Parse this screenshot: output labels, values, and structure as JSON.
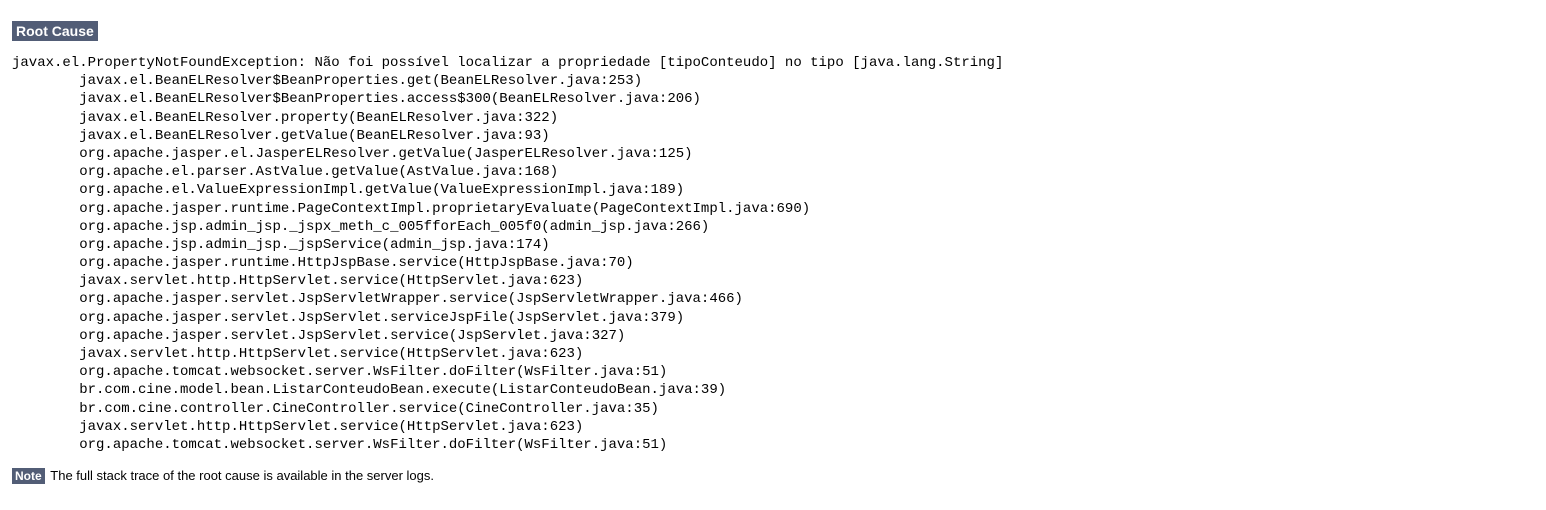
{
  "header": {
    "label": "Root Cause"
  },
  "stack": {
    "text": "javax.el.PropertyNotFoundException: Não foi possível localizar a propriedade [tipoConteudo] no tipo [java.lang.String]\n\tjavax.el.BeanELResolver$BeanProperties.get(BeanELResolver.java:253)\n\tjavax.el.BeanELResolver$BeanProperties.access$300(BeanELResolver.java:206)\n\tjavax.el.BeanELResolver.property(BeanELResolver.java:322)\n\tjavax.el.BeanELResolver.getValue(BeanELResolver.java:93)\n\torg.apache.jasper.el.JasperELResolver.getValue(JasperELResolver.java:125)\n\torg.apache.el.parser.AstValue.getValue(AstValue.java:168)\n\torg.apache.el.ValueExpressionImpl.getValue(ValueExpressionImpl.java:189)\n\torg.apache.jasper.runtime.PageContextImpl.proprietaryEvaluate(PageContextImpl.java:690)\n\torg.apache.jsp.admin_jsp._jspx_meth_c_005fforEach_005f0(admin_jsp.java:266)\n\torg.apache.jsp.admin_jsp._jspService(admin_jsp.java:174)\n\torg.apache.jasper.runtime.HttpJspBase.service(HttpJspBase.java:70)\n\tjavax.servlet.http.HttpServlet.service(HttpServlet.java:623)\n\torg.apache.jasper.servlet.JspServletWrapper.service(JspServletWrapper.java:466)\n\torg.apache.jasper.servlet.JspServlet.serviceJspFile(JspServlet.java:379)\n\torg.apache.jasper.servlet.JspServlet.service(JspServlet.java:327)\n\tjavax.servlet.http.HttpServlet.service(HttpServlet.java:623)\n\torg.apache.tomcat.websocket.server.WsFilter.doFilter(WsFilter.java:51)\n\tbr.com.cine.model.bean.ListarConteudoBean.execute(ListarConteudoBean.java:39)\n\tbr.com.cine.controller.CineController.service(CineController.java:35)\n\tjavax.servlet.http.HttpServlet.service(HttpServlet.java:623)\n\torg.apache.tomcat.websocket.server.WsFilter.doFilter(WsFilter.java:51)"
  },
  "note": {
    "label": "Note",
    "text": "The full stack trace of the root cause is available in the server logs."
  }
}
